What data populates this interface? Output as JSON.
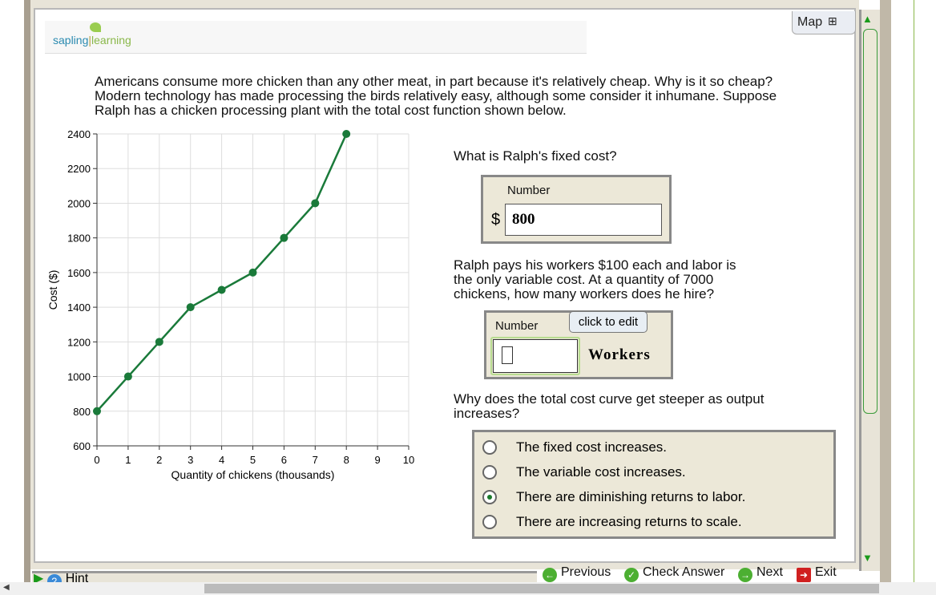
{
  "logo": {
    "part1": "sapling",
    "part2": "learning"
  },
  "map_label": "Map",
  "intro": "Americans consume more chicken than any other meat, in part because it's relatively cheap. Why is it so cheap? Modern technology has made processing the birds relatively easy, although some consider it inhumane. Suppose Ralph has a chicken processing plant with the total cost function shown below.",
  "q1": {
    "text": "What is Ralph's fixed cost?",
    "label": "Number",
    "currency": "$",
    "value": "800"
  },
  "q2": {
    "text": "Ralph pays his workers $100 each and labor is the only variable cost. At a quantity of 7000 chickens, how many workers does he hire?",
    "label": "Number",
    "tooltip": "click to edit",
    "value": "",
    "unit": "Workers"
  },
  "q3": {
    "text": "Why does the total cost curve get steeper as output increases?",
    "options": [
      "The fixed cost increases.",
      "The variable cost increases.",
      "There are diminishing returns to labor.",
      "There are increasing returns to scale."
    ],
    "selected": 2
  },
  "nav": {
    "previous": "Previous",
    "check": "Check Answer",
    "next": "Next",
    "exit": "Exit",
    "hint": "Hint"
  },
  "chart_data": {
    "type": "line",
    "title": "",
    "xlabel": "Quantity of chickens (thousands)",
    "ylabel": "Cost ($)",
    "xlim": [
      0,
      10
    ],
    "ylim": [
      600,
      2400
    ],
    "xticks": [
      0,
      1,
      2,
      3,
      4,
      5,
      6,
      7,
      8,
      9,
      10
    ],
    "yticks": [
      600,
      800,
      1000,
      1200,
      1400,
      1600,
      1800,
      2000,
      2200,
      2400
    ],
    "grid": true,
    "color": "#1a7a3a",
    "x": [
      0,
      1,
      2,
      3,
      4,
      5,
      6,
      7,
      8
    ],
    "y": [
      800,
      1000,
      1200,
      1400,
      1500,
      1600,
      1800,
      2000,
      2400
    ]
  }
}
